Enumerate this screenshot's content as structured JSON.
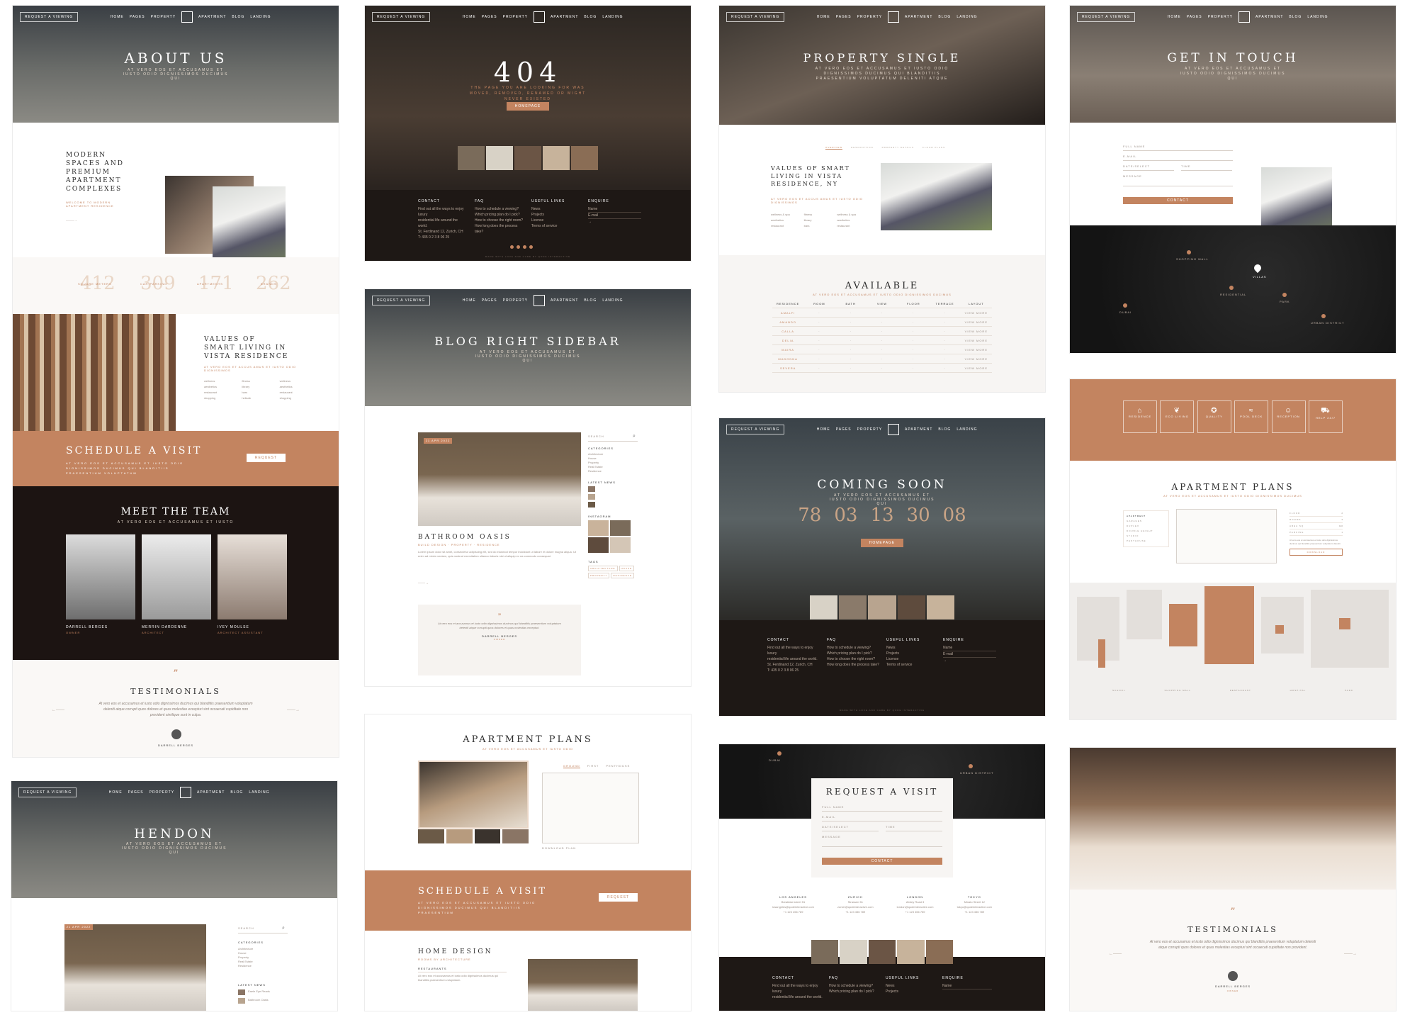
{
  "common": {
    "request_btn": "Request a Viewing",
    "nav": [
      "Home",
      "Pages",
      "Property",
      "Apartment",
      "Blog",
      "Landing"
    ],
    "accent": "#c38460"
  },
  "about": {
    "title": "About Us",
    "subtitle": "At vero eos et accusamus et iusto odio dignissimos ducimus qui",
    "intro_title": "Modern spaces and premium apartment complexes",
    "intro_sub": "Welcome to modern apartment residence",
    "stats": [
      {
        "value": "412",
        "label": "Square meters"
      },
      {
        "value": "309",
        "label": "Car parking"
      },
      {
        "value": "171",
        "label": "Apartments"
      },
      {
        "value": "262",
        "label": "Brands"
      }
    ],
    "values_title": "Values of smart living in Vista residence",
    "values_sub": "At vero eos et accus amus et iusto odio dignissimos",
    "amenities": [
      "wellness",
      "fitness",
      "wellness",
      "aesthetics",
      "library",
      "aesthetics",
      "restaurant",
      "bars",
      "restaurant",
      "shopping",
      "helicab",
      "shopping"
    ],
    "schedule_title": "Schedule a Visit",
    "schedule_sub": "At vero eos et accusamus et iusto odio dignissimos ducimus qui blanditiis praesentium voluptatum",
    "schedule_btn": "Request",
    "team_title": "Meet the Team",
    "team_sub": "At vero eos et accusamus et iusto",
    "team": [
      {
        "name": "Darrell Berges",
        "role": "Owner"
      },
      {
        "name": "Merrin Dardenne",
        "role": "Architect"
      },
      {
        "name": "Ivey Moulse",
        "role": "Architect Assistant"
      }
    ],
    "testimonials_title": "Testimonials",
    "testimonial_quote": "At vero eos et accusamus et iusto odio dignissimos ducimus qui blanditiis praesentium voluptatum deleniti atque corrupti quos dolores et quas molestias excepturi sint occaecati cupiditate non provident similique sunt in culpa.",
    "testimonial_name": "Darrell Berges"
  },
  "hendon": {
    "title": "Hendon",
    "subtitle": "At vero eos et accusamus et iusto odio dignissimos ducimus qui",
    "search": "Search",
    "tag": "21 Apr 2022",
    "categories_title": "Categories",
    "categories": [
      "Architecture",
      "House",
      "Property",
      "Real Estate",
      "Residence"
    ],
    "news_title": "Latest News",
    "news": [
      "Eaele Eye Reads",
      "Bathroom Oasis"
    ]
  },
  "e404": {
    "title": "404",
    "subtitle": "The page you are looking for was moved, removed, renamed or might never existed",
    "btn": "Homepage",
    "footer_cols": [
      {
        "title": "Contact",
        "lines": [
          "Find out all the ways to enjoy luxury",
          "residential life around the world.",
          "",
          "St. Ferdinand 12, Zurich, CH",
          "T: 435 0 2 3 8 06 25"
        ]
      },
      {
        "title": "FAQ",
        "lines": [
          "How to schedule a viewing?",
          "Which pricing plan do I pick?",
          "How to choose the right room?",
          "How long does the process take?"
        ]
      },
      {
        "title": "Useful Links",
        "lines": [
          "News",
          "Projects",
          "License",
          "Terms of service"
        ]
      },
      {
        "title": "Enquire",
        "lines": [
          "Name",
          "E-mail",
          "→"
        ]
      }
    ],
    "credit": "Made with love and care by Qode Interactive"
  },
  "blog": {
    "title": "Blog Right Sidebar",
    "subtitle": "At vero eos et accusamus et iusto odio dignissimos ducimus qui",
    "post_date": "21 Apr 2022",
    "post_title": "Bathroom Oasis",
    "post_meta": "Build Design · Property · Residence",
    "post_excerpt": "Lorem ipsum dolor sit amet, consectetur adipiscing elit, sed do eiusmod tempor incididunt ut labore et dolore magna aliqua. Ut enim ad minim veniam, quis nostrud exercitation ullamco laboris nisi ut aliquip ex ea commodo consequat.",
    "quote": "At vero eos et accusamus et iusto odio dignissimos ducimus qui blanditiis praesentium voluptatum deleniti atque corrupti quos dolores et quas molestias excepturi.",
    "quote_author": "Darrell Berges",
    "quote_role": "Owner",
    "search": "Search",
    "categories_title": "Categories",
    "categories": [
      "Architecture",
      "House",
      "Property",
      "Real Estate",
      "Residence"
    ],
    "news_title": "Latest News",
    "instagram_title": "Instagram",
    "tags_title": "Tags",
    "tags": [
      "Architecture",
      "House",
      "Property",
      "Residence"
    ]
  },
  "plans": {
    "title": "Apartment Plans",
    "subtitle": "At vero eos et accusamus et iusto odio",
    "tabs": [
      "Ground",
      "First",
      "Penthouse"
    ],
    "plan_link": "Download Plan",
    "schedule_title": "Schedule a Visit",
    "schedule_sub": "At vero eos et accusamus et iusto odio dignissimos ducimus qui blanditiis praesentium",
    "schedule_btn": "Request",
    "home_title": "Home Design",
    "home_sub": "Rooms by architecture",
    "home_item": "Restaurants",
    "home_text": "At vero eos et accusamus et iusto odio dignissimos ducimus qui blanditiis praesentium voluptatum."
  },
  "single": {
    "title": "Property Single",
    "subtitle": "At vero eos et accusamus et iusto odio dignissimos ducimus qui blanditiis praesentium voluptatum deleniti atque",
    "tabs": [
      "Overview",
      "Description",
      "Property Details",
      "Floor Plans"
    ],
    "values_title": "Values of smart living in Vista residence, NY",
    "values_sub": "At vero eos et accus amus et iusto odio dignissimos",
    "amenities": [
      "wellness & spa",
      "fitness",
      "wellness & spa",
      "aesthetics",
      "library",
      "aesthetics",
      "restaurant",
      "bars",
      "restaurant"
    ],
    "available_title": "Available",
    "available_sub": "At vero eos et accusamus et iusto odio dignissimos ducimus",
    "table_head": [
      "Residence",
      "Room",
      "Bath",
      "View",
      "Floor",
      "Terrace",
      "Layout"
    ],
    "table_rows": [
      "Amalfi",
      "Amando",
      "Calla",
      "Delia",
      "Maira",
      "Madonna",
      "Severa"
    ],
    "table_link": "View more"
  },
  "coming": {
    "title": "Coming Soon",
    "subtitle": "At vero eos et accusamus et iusto odio dignissimos ducimus qui",
    "countdown": [
      "78",
      "03",
      "13",
      "30",
      "08"
    ],
    "btn": "Homepage"
  },
  "visit": {
    "title": "Request a Visit",
    "fields": [
      "Full Name",
      "E-mail",
      "Date/Select",
      "Time",
      "Message"
    ],
    "btn": "Contact",
    "offices": [
      {
        "city": "Los Angeles",
        "line1": "Breakfast street 51",
        "line2": "losangeles@qodeinteractive.com",
        "line3": "+1 123 456 789"
      },
      {
        "city": "Zurich",
        "line1": "Strassen 51",
        "line2": "zurich@qodeinteractive.com",
        "line3": "+1 123 456 789"
      },
      {
        "city": "London",
        "line1": "Abbey Road 3",
        "line2": "london@qodeinteractive.com",
        "line3": "+1 123 456 789"
      },
      {
        "city": "Tokyo",
        "line1": "Minato Street 12",
        "line2": "tokyo@qodeinteractive.com",
        "line3": "+1 123 456 789"
      }
    ],
    "map_labels": [
      "Dubai",
      "Urban District"
    ]
  },
  "contact": {
    "title": "Get in Touch",
    "subtitle": "At vero eos et accusamus et iusto odio dignissimos ducimus qui",
    "fields": [
      "Full Name",
      "E-mail",
      "Date/Select",
      "Time",
      "Message"
    ],
    "btn": "Contact",
    "map_labels": [
      "Shopping Mall",
      "Villas",
      "Residential",
      "Park",
      "Urban District",
      "Dubai"
    ]
  },
  "features": {
    "items": [
      "Residence",
      "Eco Living",
      "Quality",
      "Pool Deck",
      "Reception",
      "Help 24/7"
    ]
  },
  "plans2": {
    "title": "Apartment Plans",
    "subtitle": "At vero eos et accusamus et iusto odio dignissimos ducimus",
    "list": [
      "Apartment",
      "Garages",
      "Duplex",
      "Double Height",
      "Studio",
      "Penthouse"
    ],
    "specs": [
      "Floor",
      "Rooms",
      "Area sq",
      "Parking"
    ],
    "spec_values": [
      "2",
      "3",
      "140",
      "1"
    ],
    "text": "At vero eos et accusamus et iusto odio dignissimos ducimus qui blanditiis praesentium voluptatum deleniti.",
    "btn": "Download",
    "map_labels": [
      "School",
      "Shopping Mall",
      "Restaurant",
      "Hospital",
      "Park"
    ]
  },
  "testimonials2": {
    "title": "Testimonials",
    "quote": "At vero eos et accusamus et iusto odio dignissimos ducimus qui blanditiis praesentium voluptatum deleniti atque corrupti quos dolores et quas molestias excepturi sint occaecati cupiditate non provident.",
    "name": "Darrell Berges",
    "role": "Owner"
  }
}
